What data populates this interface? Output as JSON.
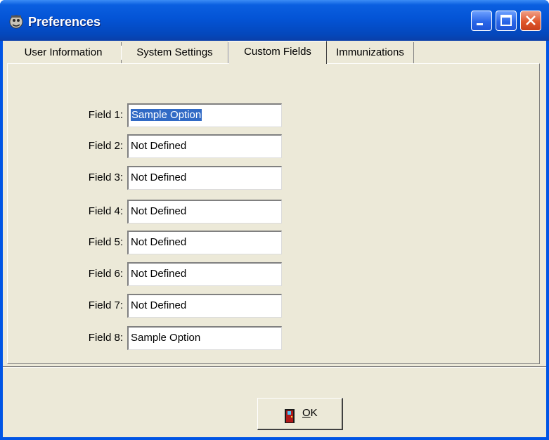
{
  "window": {
    "title": "Preferences",
    "icon": "app-icon"
  },
  "tabs": [
    {
      "label": "User Information",
      "active": false
    },
    {
      "label": "System Settings",
      "active": false
    },
    {
      "label": "Custom Fields",
      "active": true
    },
    {
      "label": "Immunizations",
      "active": false
    }
  ],
  "fields": [
    {
      "label": "Field 1:",
      "value": "Sample Option",
      "selected": true
    },
    {
      "label": "Field 2:",
      "value": "Not Defined"
    },
    {
      "label": "Field 3:",
      "value": "Not Defined"
    },
    {
      "label": "Field 4:",
      "value": "Not Defined"
    },
    {
      "label": "Field 5:",
      "value": "Not Defined"
    },
    {
      "label": "Field 6:",
      "value": "Not Defined"
    },
    {
      "label": "Field 7:",
      "value": "Not Defined"
    },
    {
      "label": "Field 8:",
      "value": "Sample Option"
    }
  ],
  "ok_button": {
    "label_accel": "O",
    "label_rest": "K",
    "icon": "door-icon"
  },
  "colors": {
    "titlebar": "#0454d6",
    "face": "#ece9d8",
    "selection": "#316ac5"
  }
}
